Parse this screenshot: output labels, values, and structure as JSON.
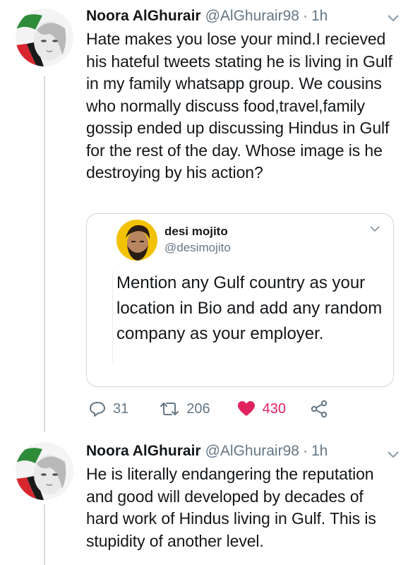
{
  "tweets": [
    {
      "author": {
        "name": "Noora AlGhurair",
        "handle": "@AlGhurair98"
      },
      "separator": "·",
      "time": "1h",
      "text": "Hate makes you lose your mind.I recieved his hateful tweets stating he is living in Gulf in my family whatsapp group. We cousins who normally discuss food,travel,family gossip ended up discussing Hindus in Gulf for the rest of the day. Whose image is he destroying by his action?",
      "quoted": {
        "author": {
          "name": "desi mojito",
          "handle": "@desimojito"
        },
        "text": "Mention any Gulf country as your location in Bio and add any random company as your employer."
      },
      "actions": {
        "replies": "31",
        "retweets": "206",
        "likes": "430"
      }
    },
    {
      "author": {
        "name": "Noora AlGhurair",
        "handle": "@AlGhurair98"
      },
      "separator": "·",
      "time": "1h",
      "text": "He is literally endangering the reputation and good will developed by decades of hard work of Hindus living in Gulf. This is stupidity of another level."
    }
  ],
  "colors": {
    "text": "#14171a",
    "secondary": "#657786",
    "like": "#e0245e",
    "border": "#ccd6dd"
  },
  "icons": [
    "reply-icon",
    "retweet-icon",
    "like-icon",
    "share-icon",
    "chevron-down-icon"
  ]
}
